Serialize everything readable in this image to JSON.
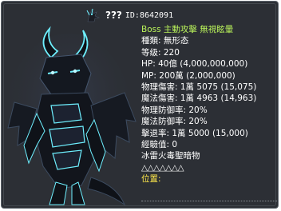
{
  "monster": {
    "name": "???",
    "id_label": "ID:8642091",
    "attributes": "Boss 主動攻擊 無視眩暈",
    "type": "種類: 無形态",
    "level": "等级: 220",
    "hp": "HP: 40億 (4,000,000,000)",
    "mp": "MP: 200萬 (2,000,000)",
    "physical_damage": "物理傷害: 1萬 5075 (15,075)",
    "magic_damage": "魔法傷害: 1萬 4963 (14,963)",
    "physical_defense": "物理防御率: 20%",
    "magic_defense": "魔法防御率: 20%",
    "knockback": "擊退率: 1萬 5000 (15,000)",
    "exp": "經驗值: 0",
    "elements": "冰雷火毒聖暗物",
    "weaknesses": "△△△△△△△",
    "location_label": "位置:"
  },
  "colors": {
    "panel": "#2c2f35",
    "accent_green": "#b9f25a",
    "accent_yellow": "#ffe84a",
    "dragon_glow": "#6ef0ff"
  },
  "icons": [
    "dragon-mini-icon",
    "dark-dragon-portrait"
  ]
}
